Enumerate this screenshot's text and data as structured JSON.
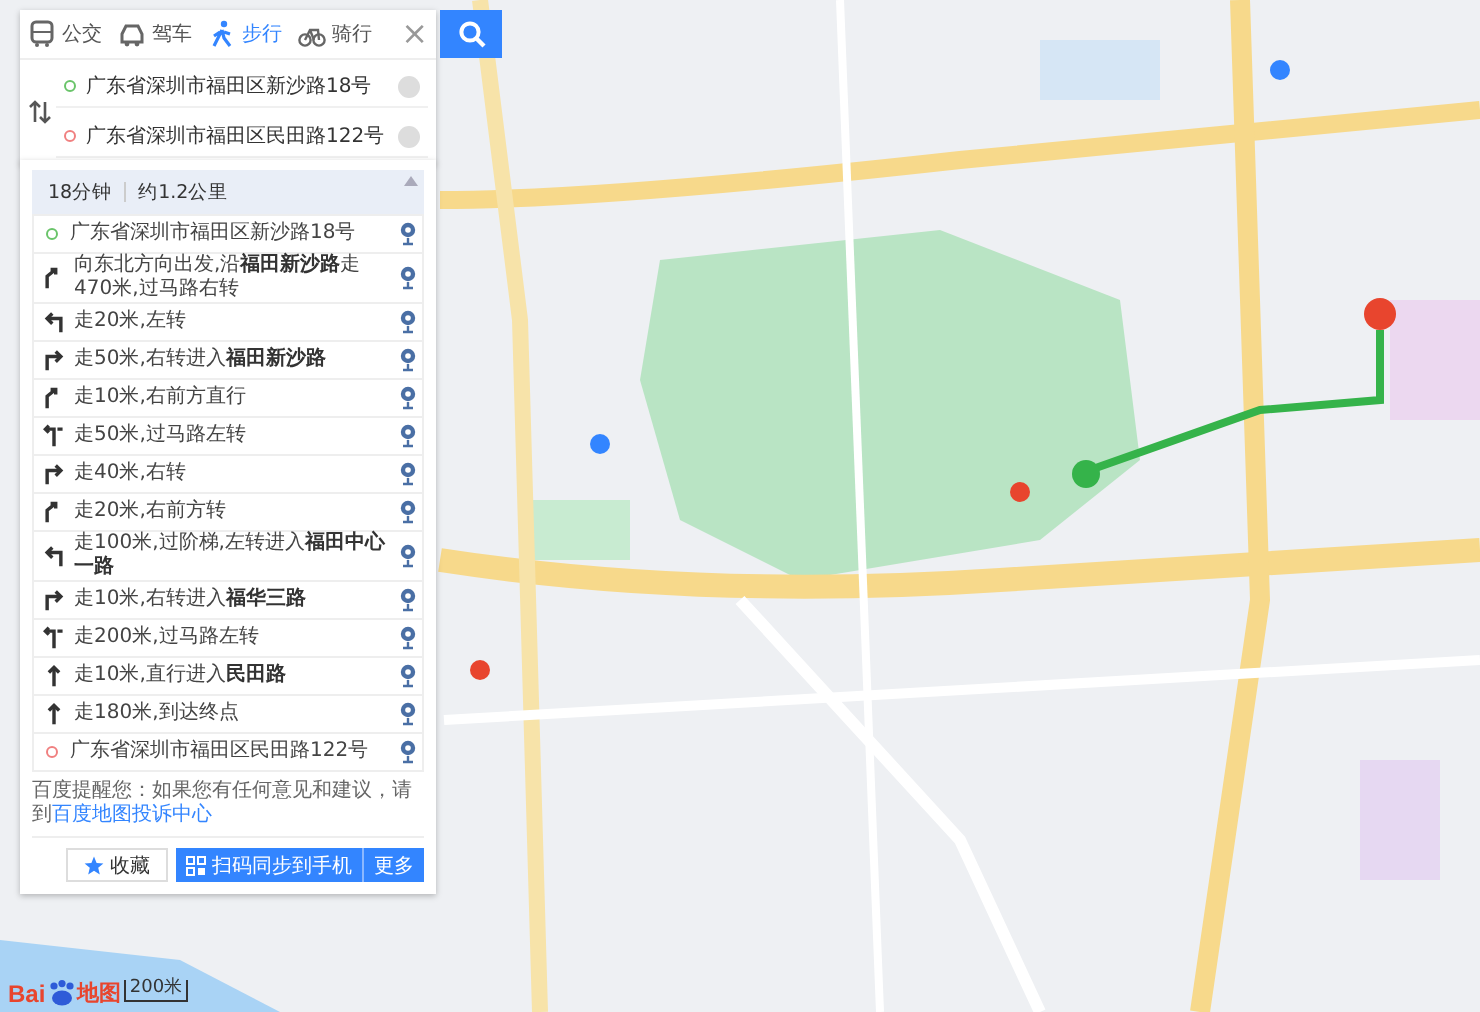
{
  "modes": [
    {
      "label": "公交",
      "kind": "bus",
      "selected": false
    },
    {
      "label": "驾车",
      "kind": "car",
      "selected": false
    },
    {
      "label": "步行",
      "kind": "walk",
      "selected": true
    },
    {
      "label": "骑行",
      "kind": "bike",
      "selected": false
    }
  ],
  "close": "×",
  "start": {
    "value": "广东省深圳市福田区新沙路18号"
  },
  "end": {
    "value": "广东省深圳市福田区民田路122号"
  },
  "route": {
    "time": "18分钟",
    "distance": "约1.2公里"
  },
  "steps": [
    {
      "kind": "start",
      "text": "广东省深圳市福田区新沙路18号"
    },
    {
      "kind": "right-front",
      "text": "向东北方向出发,沿**福田新沙路**走470米,过马路右转"
    },
    {
      "kind": "left",
      "text": "走20米,左转"
    },
    {
      "kind": "right",
      "text": "走50米,右转进入**福田新沙路**"
    },
    {
      "kind": "right-front",
      "text": "走10米,右前方直行"
    },
    {
      "kind": "cross-left",
      "text": "走50米,过马路左转"
    },
    {
      "kind": "right",
      "text": "走40米,右转"
    },
    {
      "kind": "right-front",
      "text": "走20米,右前方转"
    },
    {
      "kind": "left",
      "text": "走100米,过阶梯,左转进入**福田中心一路**"
    },
    {
      "kind": "right",
      "text": "走10米,右转进入**福华三路**"
    },
    {
      "kind": "cross-left",
      "text": "走200米,过马路左转"
    },
    {
      "kind": "straight",
      "text": "走10米,直行进入**民田路**"
    },
    {
      "kind": "straight",
      "text": "走180米,到达终点"
    },
    {
      "kind": "end",
      "text": "广东省深圳市福田区民田路122号"
    }
  ],
  "notice": {
    "text": "百度提醒您：如果您有任何意见和建议，请到",
    "link": "百度地图投诉中心"
  },
  "actions": {
    "favorite": "收藏",
    "send": "扫码同步到手机",
    "more": "更多"
  },
  "logo": {
    "latin": "Bai",
    "cjk": "地图"
  },
  "scale": "200米"
}
